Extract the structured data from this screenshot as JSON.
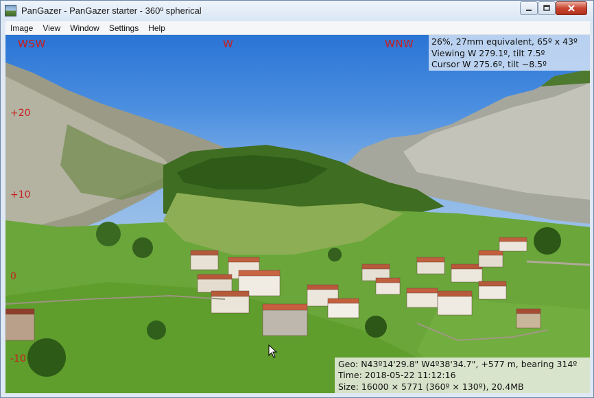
{
  "window": {
    "title": "PanGazer - PanGazer starter - 360º spherical"
  },
  "menu": {
    "items": [
      "Image",
      "View",
      "Window",
      "Settings",
      "Help"
    ]
  },
  "compass": {
    "left": "WSW",
    "center": "W",
    "right": "WNW",
    "color": "#c81e1e"
  },
  "tilt_labels": [
    "+20",
    "+10",
    "0",
    "-10"
  ],
  "info": {
    "line1": "26%, 27mm equivalent, 65º x 43º",
    "line2": "Viewing W 279.1º, tilt 7.5º",
    "line3": "Cursor W 275.6º, tilt −8.5º"
  },
  "meta": {
    "geo": "Geo: N43º14'29.8\" W4º38'34.7\", +577 m, bearing 314º",
    "time": "Time: 2018-05-22 11:12:16",
    "size": "Size: 16000 × 5771 (360º × 130º), 20.4MB"
  }
}
